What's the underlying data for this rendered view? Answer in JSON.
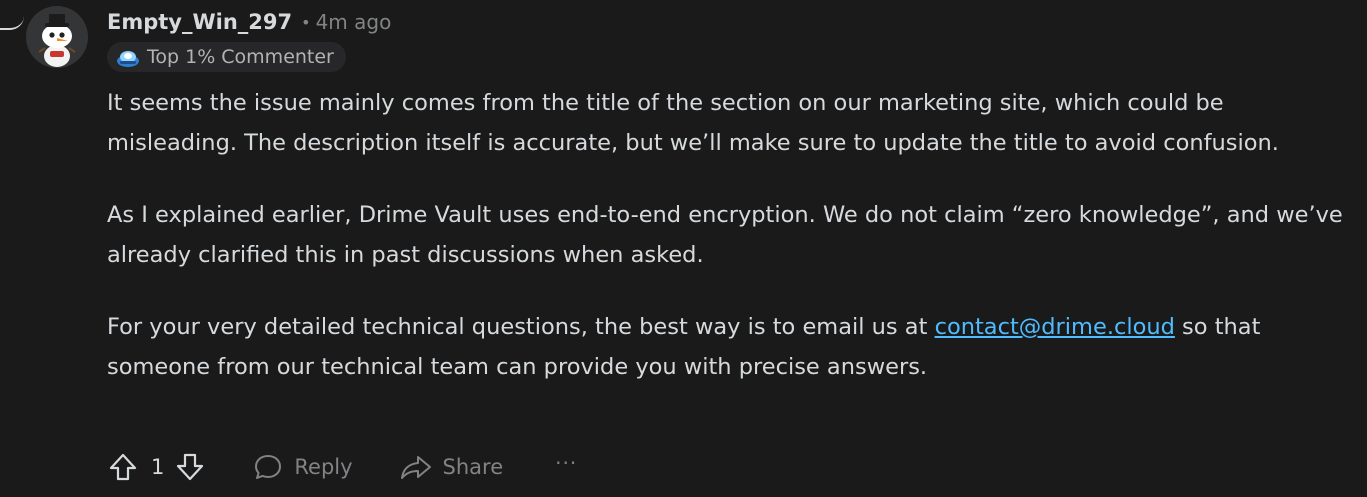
{
  "comment": {
    "author": "Empty_Win_297",
    "separator": "•",
    "time": "4m ago",
    "flair": "Top 1% Commenter",
    "paragraphs": {
      "p1": "It seems the issue mainly comes from the title of the section on our marketing site, which could be misleading. The description itself is accurate, but we’ll make sure to update the title to avoid confusion.",
      "p2": "As I explained earlier, Drime Vault uses end-to-end encryption. We do not claim “zero knowledge”, and we’ve already clarified this in past discussions when asked.",
      "p3_before": "For your very detailed technical questions, the best way is to email us at ",
      "p3_link": "contact@drime.cloud",
      "p3_after": " so that someone from our technical team can provide you with precise answers."
    }
  },
  "actions": {
    "score": "1",
    "reply_label": "Reply",
    "share_label": "Share",
    "more_label": "···"
  },
  "icons": {
    "avatar": "snoo-snowman-avatar",
    "flair": "commenter-badge-icon",
    "upvote": "arrow-up-icon",
    "downvote": "arrow-down-icon",
    "reply": "speech-bubble-icon",
    "share": "share-arrow-icon",
    "more": "ellipsis-icon"
  },
  "colors": {
    "background": "#1a1a1b",
    "text": "#d7dadc",
    "muted": "#818384",
    "link": "#4fbcff"
  }
}
